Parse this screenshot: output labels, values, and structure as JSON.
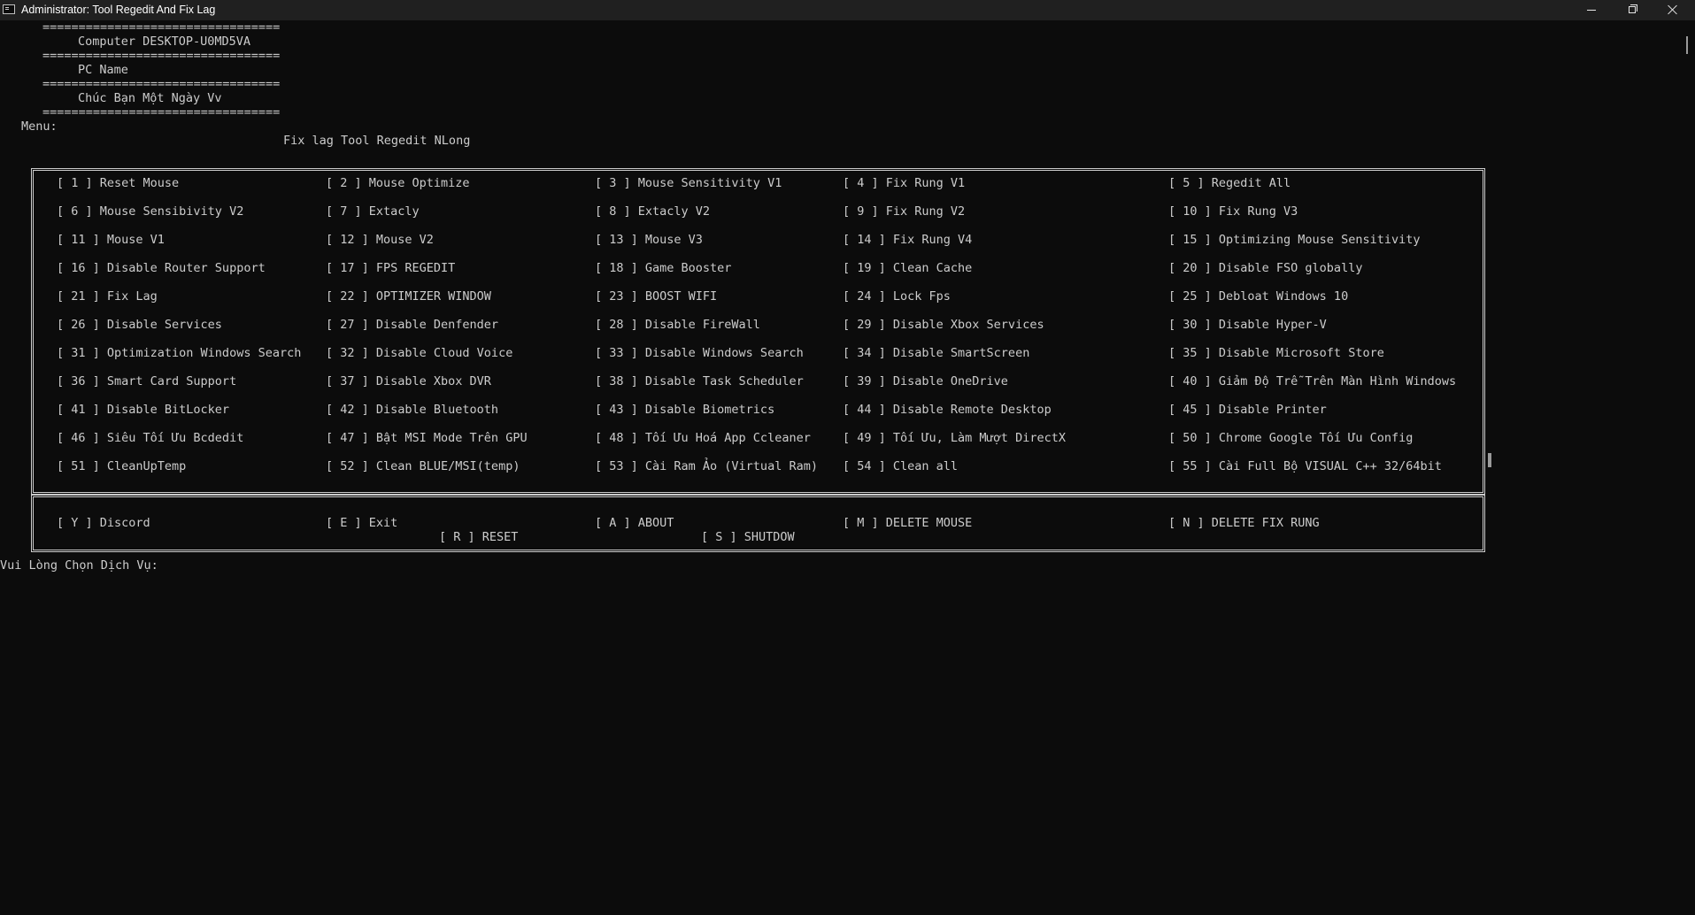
{
  "window": {
    "title": "Administrator: Tool Regedit And Fix Lag"
  },
  "header": {
    "separator": "=================================",
    "computer_line": "Computer DESKTOP-U0MD5VA",
    "pc_name_line": "PC Name",
    "greeting_line": "Chúc Bạn Một Ngày Vv"
  },
  "menu_label": "Menu:",
  "menu_title": "Fix lag Tool Regedit NLong",
  "options": [
    [
      "[ 1 ] Reset Mouse",
      "[ 2 ] Mouse Optimize",
      "[ 3 ] Mouse Sensitivity V1",
      "[ 4 ] Fix Rung V1",
      "[ 5 ] Regedit All"
    ],
    [
      "[ 6 ] Mouse Sensibivity V2",
      "[ 7 ] Extacly",
      "[ 8 ] Extacly V2",
      "[ 9 ] Fix Rung V2",
      "[ 10 ] Fix Rung V3"
    ],
    [
      "[ 11 ] Mouse V1",
      "[ 12 ] Mouse V2",
      "[ 13 ] Mouse V3",
      "[ 14 ] Fix Rung V4",
      "[ 15 ] Optimizing Mouse Sensitivity"
    ],
    [
      "[ 16 ] Disable Router Support",
      "[ 17 ] FPS REGEDIT",
      "[ 18 ] Game Booster",
      "[ 19 ] Clean Cache",
      "[ 20 ] Disable FSO globally"
    ],
    [
      "[ 21 ] Fix Lag",
      "[ 22 ] OPTIMIZER WINDOW",
      "[ 23 ] BOOST WIFI",
      "[ 24 ] Lock Fps",
      "[ 25 ] Debloat Windows 10"
    ],
    [
      "[ 26 ] Disable Services",
      "[ 27 ] Disable Denfender",
      "[ 28 ] Disable FireWall",
      "[ 29 ] Disable Xbox Services",
      "[ 30 ] Disable Hyper-V"
    ],
    [
      "[ 31 ] Optimization Windows Search",
      "[ 32 ] Disable Cloud Voice",
      "[ 33 ] Disable Windows Search",
      "[ 34 ] Disable SmartScreen",
      "[ 35 ] Disable Microsoft Store"
    ],
    [
      "[ 36 ] Smart Card Support",
      "[ 37 ] Disable Xbox DVR",
      "[ 38 ] Disable Task Scheduler",
      "[ 39 ] Disable OneDrive",
      "[ 40 ] Giảm Độ Trễ Trên Màn Hình Windows"
    ],
    [
      "[ 41 ] Disable BitLocker",
      "[ 42 ] Disable Bluetooth",
      "[ 43 ] Disable Biometrics",
      "[ 44 ] Disable Remote Desktop",
      "[ 45 ] Disable Printer"
    ],
    [
      "[ 46 ] Siêu Tối Ưu Bcdedit",
      "[ 47 ] Bật MSI Mode Trên GPU",
      "[ 48 ] Tối Ưu Hoá App Ccleaner",
      "[ 49 ] Tối Ưu, Làm Mượt DirectX",
      "[ 50 ] Chrome Google Tối Ưu Config"
    ],
    [
      "[ 51 ] CleanUpTemp",
      "[ 52 ] Clean BLUE/MSI(temp)",
      "[ 53 ] Cài Ram Ảo (Virtual Ram)",
      "[ 54 ] Clean all",
      "[ 55 ] Cài Full Bộ VISUAL C++ 32/64bit"
    ]
  ],
  "actions": {
    "discord": "[ Y ] Discord",
    "exit": "[ E ] Exit",
    "about": "[ A ] ABOUT",
    "delete_mouse": "[ M ] DELETE MOUSE",
    "delete_fix_rung": "[ N ] DELETE FIX RUNG",
    "reset": "[ R ] RESET",
    "shutdown": "[ S ] SHUTDOW"
  },
  "prompt": "Vui Lòng Chọn Dịch Vụ:"
}
